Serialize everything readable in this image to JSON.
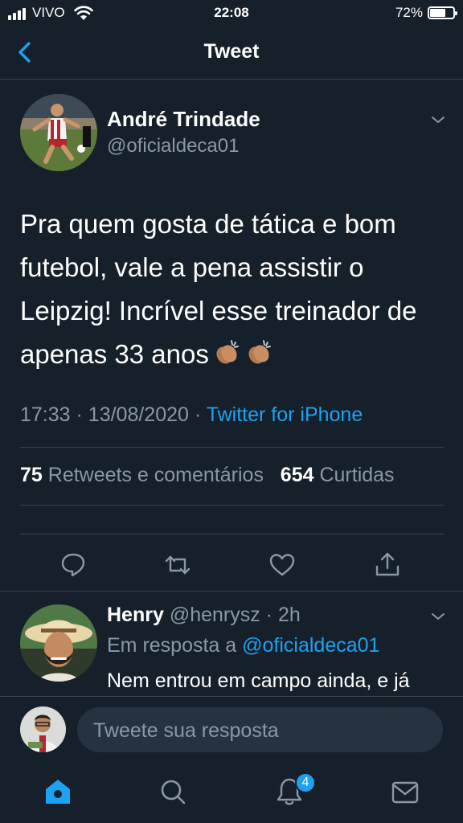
{
  "status_bar": {
    "carrier": "VIVO",
    "time": "22:08",
    "battery": "72%",
    "battery_level": 0.72
  },
  "header": {
    "title": "Tweet",
    "back_icon": "chevron-left-icon"
  },
  "tweet": {
    "author_name": "André Trindade",
    "author_handle": "@oficialdeca01",
    "text": "Pra quem gosta de tática e bom futebol, vale a pena assistir o Leipzig! Incrível esse treinador de apenas 33 anos",
    "emoji": [
      "clapping-hands-emoji",
      "clapping-hands-emoji"
    ],
    "time": "17:33",
    "date": "13/08/2020",
    "sep": "·",
    "source": "Twitter for iPhone",
    "retweets_count": "75",
    "retweets_label": "Retweets e comentários",
    "likes_count": "654",
    "likes_label": "Curtidas",
    "actions": [
      "reply-icon",
      "retweet-icon",
      "like-icon",
      "share-icon"
    ]
  },
  "reply": {
    "author_name": "Henry",
    "author_handle": "@henrysz",
    "time": "· 2h",
    "in_reply_label": "Em resposta a",
    "in_reply_handle": "@oficialdeca01",
    "text": "Nem entrou em campo ainda, e já"
  },
  "composer": {
    "placeholder": "Tweete sua resposta"
  },
  "tabbar": {
    "tabs": [
      "home-icon",
      "search-icon",
      "notifications-icon",
      "messages-icon"
    ],
    "notifications_badge": "4"
  },
  "colors": {
    "background": "#15202b",
    "accent": "#1da1f2",
    "secondary_text": "#8899a6",
    "divider": "#38444d"
  }
}
